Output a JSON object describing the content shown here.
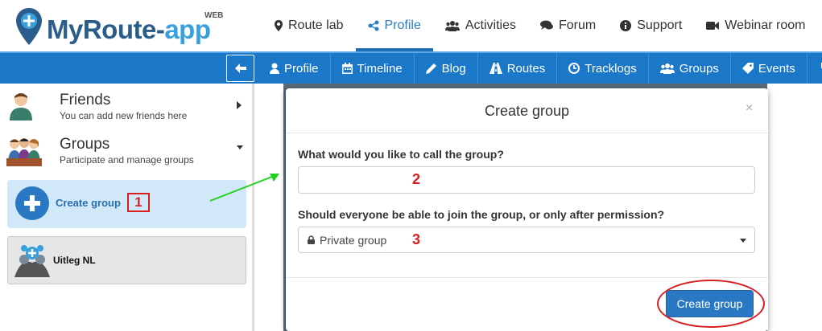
{
  "app": {
    "logo_main": "MyRoute-",
    "logo_accent": "app",
    "logo_badge": "WEB"
  },
  "topnav": [
    {
      "label": "Route lab",
      "icon": "map-marker-icon"
    },
    {
      "label": "Profile",
      "icon": "share-icon",
      "active": true
    },
    {
      "label": "Activities",
      "icon": "users-icon"
    },
    {
      "label": "Forum",
      "icon": "comments-icon"
    },
    {
      "label": "Support",
      "icon": "info-icon"
    },
    {
      "label": "Webinar room",
      "icon": "video-camera-icon"
    }
  ],
  "subnav": [
    {
      "label": "Profile",
      "icon": "user-icon"
    },
    {
      "label": "Timeline",
      "icon": "calendar-icon"
    },
    {
      "label": "Blog",
      "icon": "pencil-icon"
    },
    {
      "label": "Routes",
      "icon": "road-icon"
    },
    {
      "label": "Tracklogs",
      "icon": "clock-icon"
    },
    {
      "label": "Groups",
      "icon": "users-icon"
    },
    {
      "label": "Events",
      "icon": "tag-icon"
    }
  ],
  "sidebar": {
    "friends": {
      "title": "Friends",
      "subtitle": "You can add new friends here"
    },
    "groups": {
      "title": "Groups",
      "subtitle": "Participate and manage groups"
    },
    "create_group_label": "Create group",
    "group_items": [
      {
        "name": "Uitleg NL"
      }
    ]
  },
  "modal": {
    "title": "Create group",
    "close": "×",
    "question_name": "What would you like to call the group?",
    "name_value": "",
    "question_permission": "Should everyone be able to join the group, or only after permission?",
    "permission_value": "Private group",
    "submit_label": "Create group"
  },
  "annotations": {
    "step1": "1",
    "step2": "2",
    "step3": "3"
  },
  "colors": {
    "brand_blue": "#1b78c9",
    "primary_button": "#2a78c4",
    "annotation_red": "#d81f1f",
    "arrow_green": "#1fd01f"
  }
}
